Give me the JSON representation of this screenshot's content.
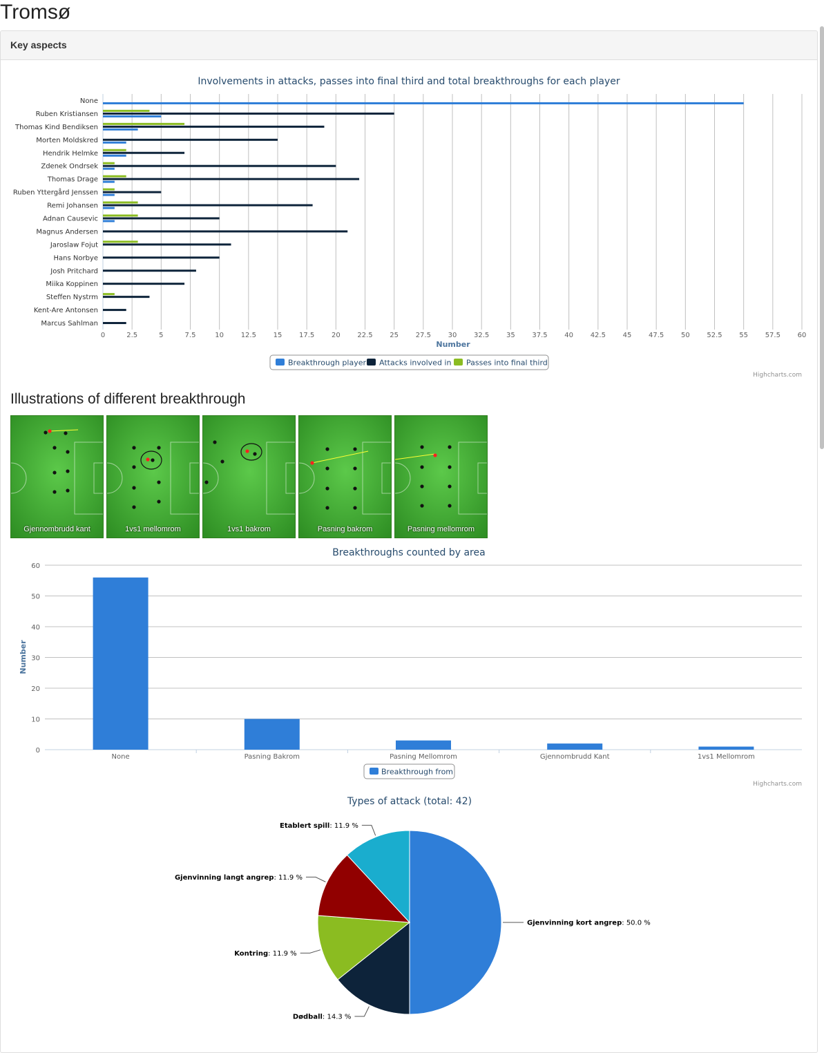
{
  "page": {
    "title": "Tromsø",
    "panel_heading": "Key aspects",
    "illustrations_heading": "Illustrations of different breakthrough",
    "credits": "Highcharts.com"
  },
  "illustrations": [
    {
      "caption": "Gjennombrudd kant"
    },
    {
      "caption": "1vs1 mellomrom"
    },
    {
      "caption": "1vs1 bakrom"
    },
    {
      "caption": "Pasning bakrom"
    },
    {
      "caption": "Pasning mellomrom"
    }
  ],
  "chart_data": [
    {
      "type": "bar",
      "orientation": "horizontal",
      "title": "Involvements in attacks, passes into final third and total breakthroughs for each player",
      "xlabel": "Number",
      "ylabel": "",
      "xlim": [
        0,
        60
      ],
      "tick_labels": [
        "0",
        "2.5",
        "5",
        "7.5",
        "10",
        "12.5",
        "15",
        "17.5",
        "20",
        "22.5",
        "25",
        "27.5",
        "30",
        "32.5",
        "35",
        "37.5",
        "40",
        "42.5",
        "45",
        "47.5",
        "50",
        "52.5",
        "55",
        "57.5",
        "60"
      ],
      "grid": true,
      "legend_position": "bottom",
      "categories": [
        "None",
        "Ruben Kristiansen",
        "Thomas Kind Bendiksen",
        "Morten Moldskred",
        "Hendrik Helmke",
        "Zdenek Ondrsek",
        "Thomas Drage",
        "Ruben Yttergård Jenssen",
        "Remi Johansen",
        "Adnan Causevic",
        "Magnus Andersen",
        "Jaroslaw Fojut",
        "Hans Norbye",
        "Josh Pritchard",
        "Miika Koppinen",
        "Steffen Nystrm",
        "Kent-Are Antonsen",
        "Marcus Sahlman"
      ],
      "series": [
        {
          "name": "Breakthrough player",
          "color": "#2f7ed8",
          "values": [
            55,
            5,
            3,
            2,
            2,
            1,
            1,
            1,
            1,
            1,
            0,
            0,
            0,
            0,
            0,
            0,
            0,
            0
          ]
        },
        {
          "name": "Attacks involved in",
          "color": "#0d233a",
          "values": [
            0,
            25,
            19,
            15,
            7,
            20,
            22,
            5,
            18,
            10,
            21,
            11,
            10,
            8,
            7,
            4,
            2,
            2
          ]
        },
        {
          "name": "Passes into final third",
          "color": "#8bbc21",
          "values": [
            0,
            4,
            7,
            0,
            2,
            1,
            2,
            1,
            3,
            3,
            0,
            3,
            0,
            0,
            0,
            1,
            0,
            0
          ]
        }
      ]
    },
    {
      "type": "bar",
      "title": "Breakthroughs counted by area",
      "xlabel": "",
      "ylabel": "Number",
      "ylim": [
        0,
        60
      ],
      "tick_labels": [
        "0",
        "10",
        "20",
        "30",
        "40",
        "50",
        "60"
      ],
      "grid": true,
      "legend_position": "bottom",
      "categories": [
        "None",
        "Pasning Bakrom",
        "Pasning Mellomrom",
        "Gjennombrudd Kant",
        "1vs1 Mellomrom"
      ],
      "series": [
        {
          "name": "Breakthrough from",
          "color": "#2f7ed8",
          "values": [
            56,
            10,
            3,
            2,
            1
          ]
        }
      ]
    },
    {
      "type": "pie",
      "title": "Types of attack (total: 42)",
      "slices": [
        {
          "name": "Gjenvinning kort angrep",
          "value": 50.0,
          "label": "50.0 %",
          "color": "#2f7ed8"
        },
        {
          "name": "Dødball",
          "value": 14.3,
          "label": "14.3 %",
          "color": "#0d233a"
        },
        {
          "name": "Kontring",
          "value": 11.9,
          "label": "11.9 %",
          "color": "#8bbc21"
        },
        {
          "name": "Gjenvinning langt angrep",
          "value": 11.9,
          "label": "11.9 %",
          "color": "#910000"
        },
        {
          "name": "Etablert spill",
          "value": 11.9,
          "label": "11.9 %",
          "color": "#1aadce"
        }
      ]
    }
  ]
}
